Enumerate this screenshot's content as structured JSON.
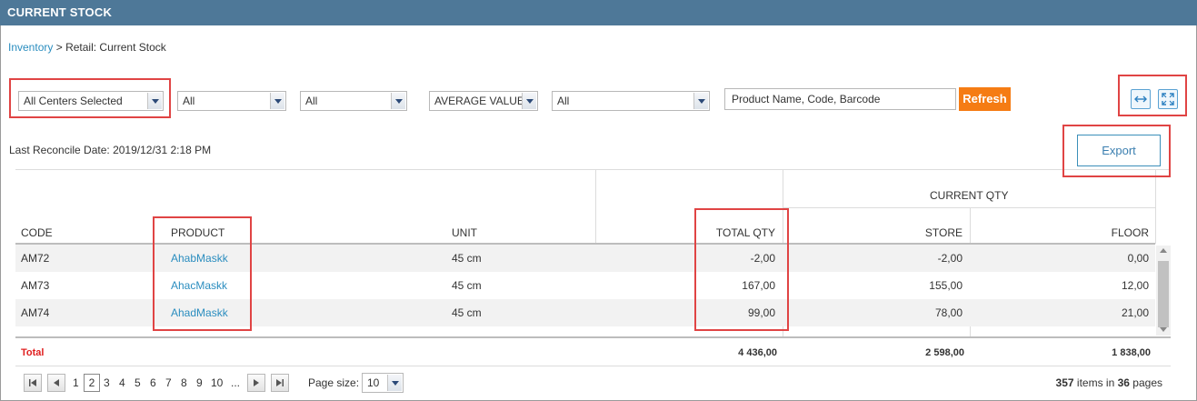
{
  "window": {
    "title": "CURRENT STOCK"
  },
  "breadcrumb": {
    "link": "Inventory",
    "separator": ">",
    "current": "Retail: Current Stock"
  },
  "filters": {
    "centers": "All Centers Selected",
    "filter2": "All",
    "filter3": "All",
    "valuation": "AVERAGE VALUE",
    "filter5": "All",
    "search_placeholder": "Product Name, Code, Barcode",
    "refresh_label": "Refresh"
  },
  "toolbar": {
    "expand_horizontal_icon": "arrows-horizontal-icon",
    "fullscreen_icon": "fullscreen-icon"
  },
  "reconcile": {
    "label": "Last Reconcile Date:",
    "value": "2019/12/31 2:18 PM"
  },
  "export_label": "Export",
  "table": {
    "group_header": "CURRENT QTY",
    "columns": {
      "code": "CODE",
      "product": "PRODUCT",
      "unit": "UNIT",
      "total_qty": "TOTAL QTY",
      "store": "STORE",
      "floor": "FLOOR"
    },
    "rows": [
      {
        "code": "AM72",
        "product": "AhabMaskk",
        "unit": "45 cm",
        "total_qty": "-2,00",
        "store": "-2,00",
        "floor": "0,00"
      },
      {
        "code": "AM73",
        "product": "AhacMaskk",
        "unit": "45 cm",
        "total_qty": "167,00",
        "store": "155,00",
        "floor": "12,00"
      },
      {
        "code": "AM74",
        "product": "AhadMaskk",
        "unit": "45 cm",
        "total_qty": "99,00",
        "store": "78,00",
        "floor": "21,00"
      }
    ],
    "totals": {
      "label": "Total",
      "total_qty": "4 436,00",
      "store": "2 598,00",
      "floor": "1 838,00"
    }
  },
  "pager": {
    "pages": [
      "1",
      "2",
      "3",
      "4",
      "5",
      "6",
      "7",
      "8",
      "9",
      "10"
    ],
    "current_page": "2",
    "ellipsis": "...",
    "page_size_label": "Page size:",
    "page_size": "10",
    "items_count": "357",
    "items_text": "items in",
    "pages_count": "36",
    "pages_text": "pages"
  },
  "colors": {
    "titlebar": "#4e7898",
    "accent_link": "#2a8dbf",
    "refresh": "#f57c14",
    "total_label": "#e02020",
    "highlight_box": "#e04444"
  }
}
